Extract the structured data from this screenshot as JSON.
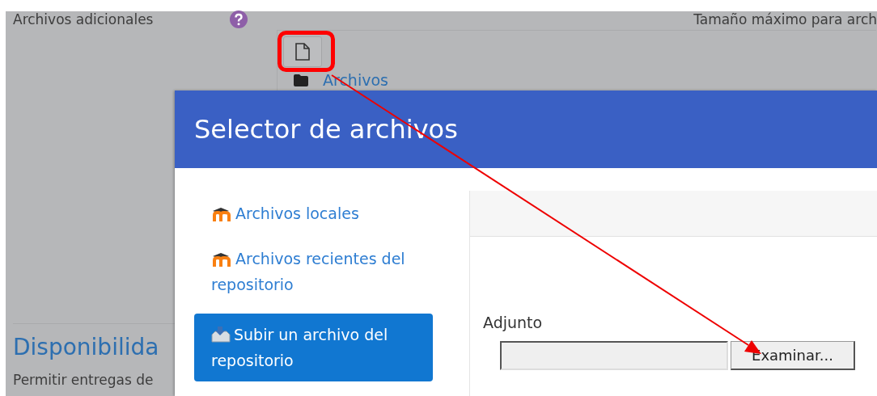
{
  "page": {
    "field_label": "Archivos adicionales",
    "max_size_text": "Tamaño máximo para arch",
    "folder_link": "Archivos",
    "section_title": "Disponibilida",
    "section_text": "Permitir entregas de"
  },
  "dialog": {
    "title": "Selector de archivos",
    "repositories": [
      {
        "label": "Archivos locales",
        "kind": "moodle",
        "selected": false
      },
      {
        "label": "Archivos recientes del repositorio",
        "kind": "moodle",
        "selected": false
      },
      {
        "label": "Subir un archivo del repositorio",
        "kind": "upload",
        "selected": true
      }
    ],
    "upload": {
      "label": "Adjunto",
      "button": "Examinar..."
    }
  }
}
